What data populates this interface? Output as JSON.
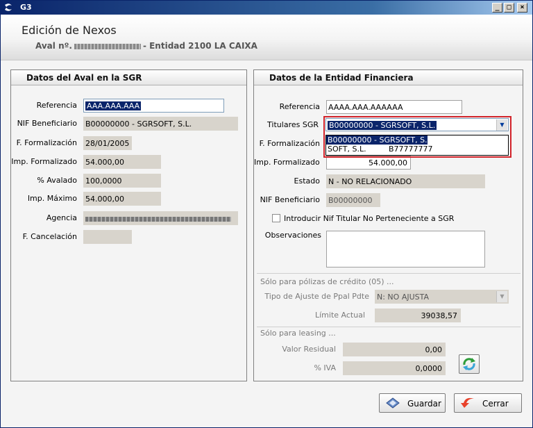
{
  "window": {
    "title": "G3"
  },
  "header": {
    "title": "Edición de Nexos",
    "subtitle_prefix": "Aval nº.",
    "subtitle_suffix": "- Entidad 2100 LA CAIXA"
  },
  "left_panel": {
    "title": "Datos del Aval en la SGR",
    "fields": {
      "referencia": {
        "label": "Referencia",
        "value": "AAA.AAA.AAA"
      },
      "nif_beneficiario": {
        "label": "NIF Beneficiario",
        "value": "B00000000 - SGRSOFT, S.L."
      },
      "f_formalizacion": {
        "label": "F. Formalización",
        "value": "28/01/2005"
      },
      "imp_formalizado": {
        "label": "Imp. Formalizado",
        "value": "54.000,00"
      },
      "pct_avalado": {
        "label": "% Avalado",
        "value": "100,0000"
      },
      "imp_maximo": {
        "label": "Imp. Máximo",
        "value": "54.000,00"
      },
      "agencia": {
        "label": "Agencia",
        "value": ""
      },
      "f_cancelacion": {
        "label": "F. Cancelación",
        "value": ""
      }
    }
  },
  "right_panel": {
    "title": "Datos de la Entidad Financiera",
    "fields": {
      "referencia": {
        "label": "Referencia",
        "value": "AAAA.AAA.AAAAAA"
      },
      "titulares_sgr": {
        "label": "Titulares SGR",
        "value": "B00000000 - SGRSOFT, S.L.",
        "options": [
          {
            "nif": "B00000000 - SGRSOFT, S.L.",
            "name": ""
          },
          {
            "nif": "SOFT, S.L.",
            "name": "B77777777"
          }
        ]
      },
      "f_formalizacion": {
        "label": "F. Formalización",
        "value": ""
      },
      "imp_formalizado": {
        "label": "Imp. Formalizado",
        "value": "54.000,00"
      },
      "estado": {
        "label": "Estado",
        "value": "N - NO  RELACIONADO"
      },
      "nif_beneficiario": {
        "label": "NIF Beneficiario",
        "value": "B00000000"
      },
      "checkbox_nif": {
        "label": "Introducir Nif Titular No Perteneciente a SGR",
        "checked": false
      },
      "observaciones": {
        "label": "Observaciones",
        "value": ""
      }
    },
    "credit_section": {
      "title": "Sólo para pólizas de crédito (05) ...",
      "tipo_ajuste": {
        "label": "Tipo de Ajuste de Ppal Pdte",
        "value": "N: NO AJUSTA"
      },
      "limite_actual": {
        "label": "Límite Actual",
        "value": "39038,57"
      }
    },
    "leasing_section": {
      "title": "Sólo para leasing ...",
      "valor_residual": {
        "label": "Valor Residual",
        "value": "0,00"
      },
      "pct_iva": {
        "label": "% IVA",
        "value": "0,0000"
      }
    }
  },
  "footer": {
    "save_label": "Guardar",
    "close_label": "Cerrar"
  },
  "icons": {
    "app": "g3-logo-icon",
    "save": "save-disk-icon",
    "close": "close-arrow-icon",
    "refresh": "refresh-icon"
  },
  "colors": {
    "accent": "#0a246a",
    "highlight": "#d2232a",
    "field_bg": "#d8d4cc"
  }
}
